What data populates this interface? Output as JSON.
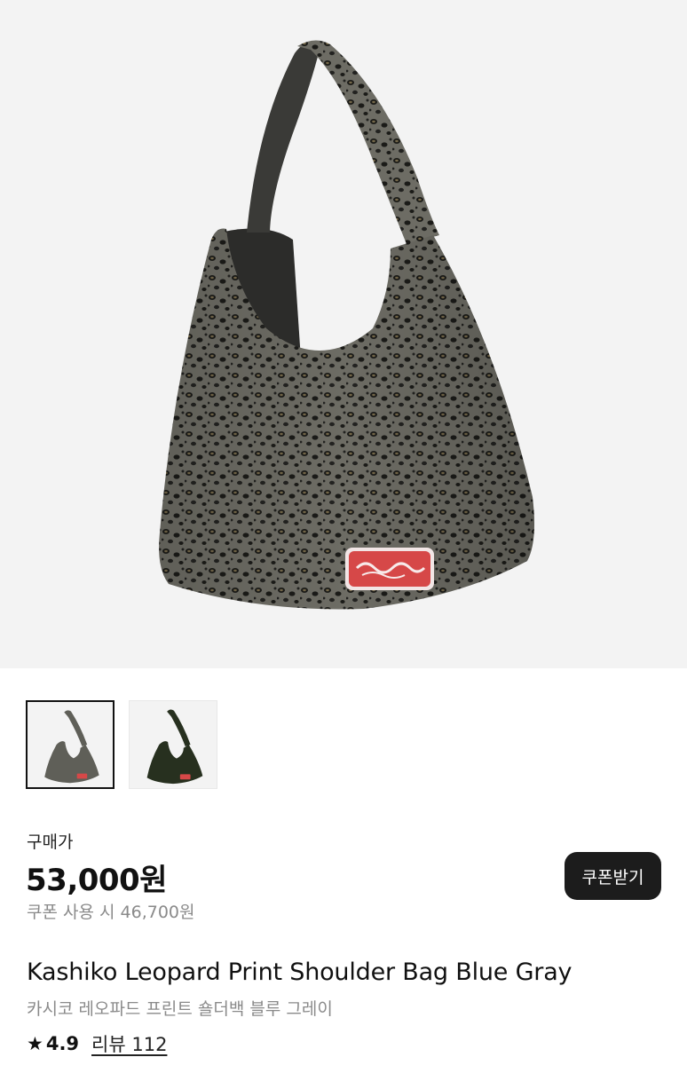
{
  "product": {
    "thumbnails": [
      {
        "color": "#5f5f58",
        "selected": true,
        "name": "blue-gray"
      },
      {
        "color": "#27301f",
        "selected": false,
        "name": "khaki"
      }
    ],
    "price_label": "구매가",
    "price": "53,000원",
    "coupon_price": "쿠폰 사용 시 46,700원",
    "coupon_button": "쿠폰받기",
    "name_en": "Kashiko Leopard Print Shoulder Bag Blue Gray",
    "name_ko": "카시코 레오파드 프린트 숄더백 블루 그레이",
    "rating_icon": "star-icon",
    "rating": "4.9",
    "reviews": "리뷰 112",
    "patch_color": "#d64848"
  }
}
